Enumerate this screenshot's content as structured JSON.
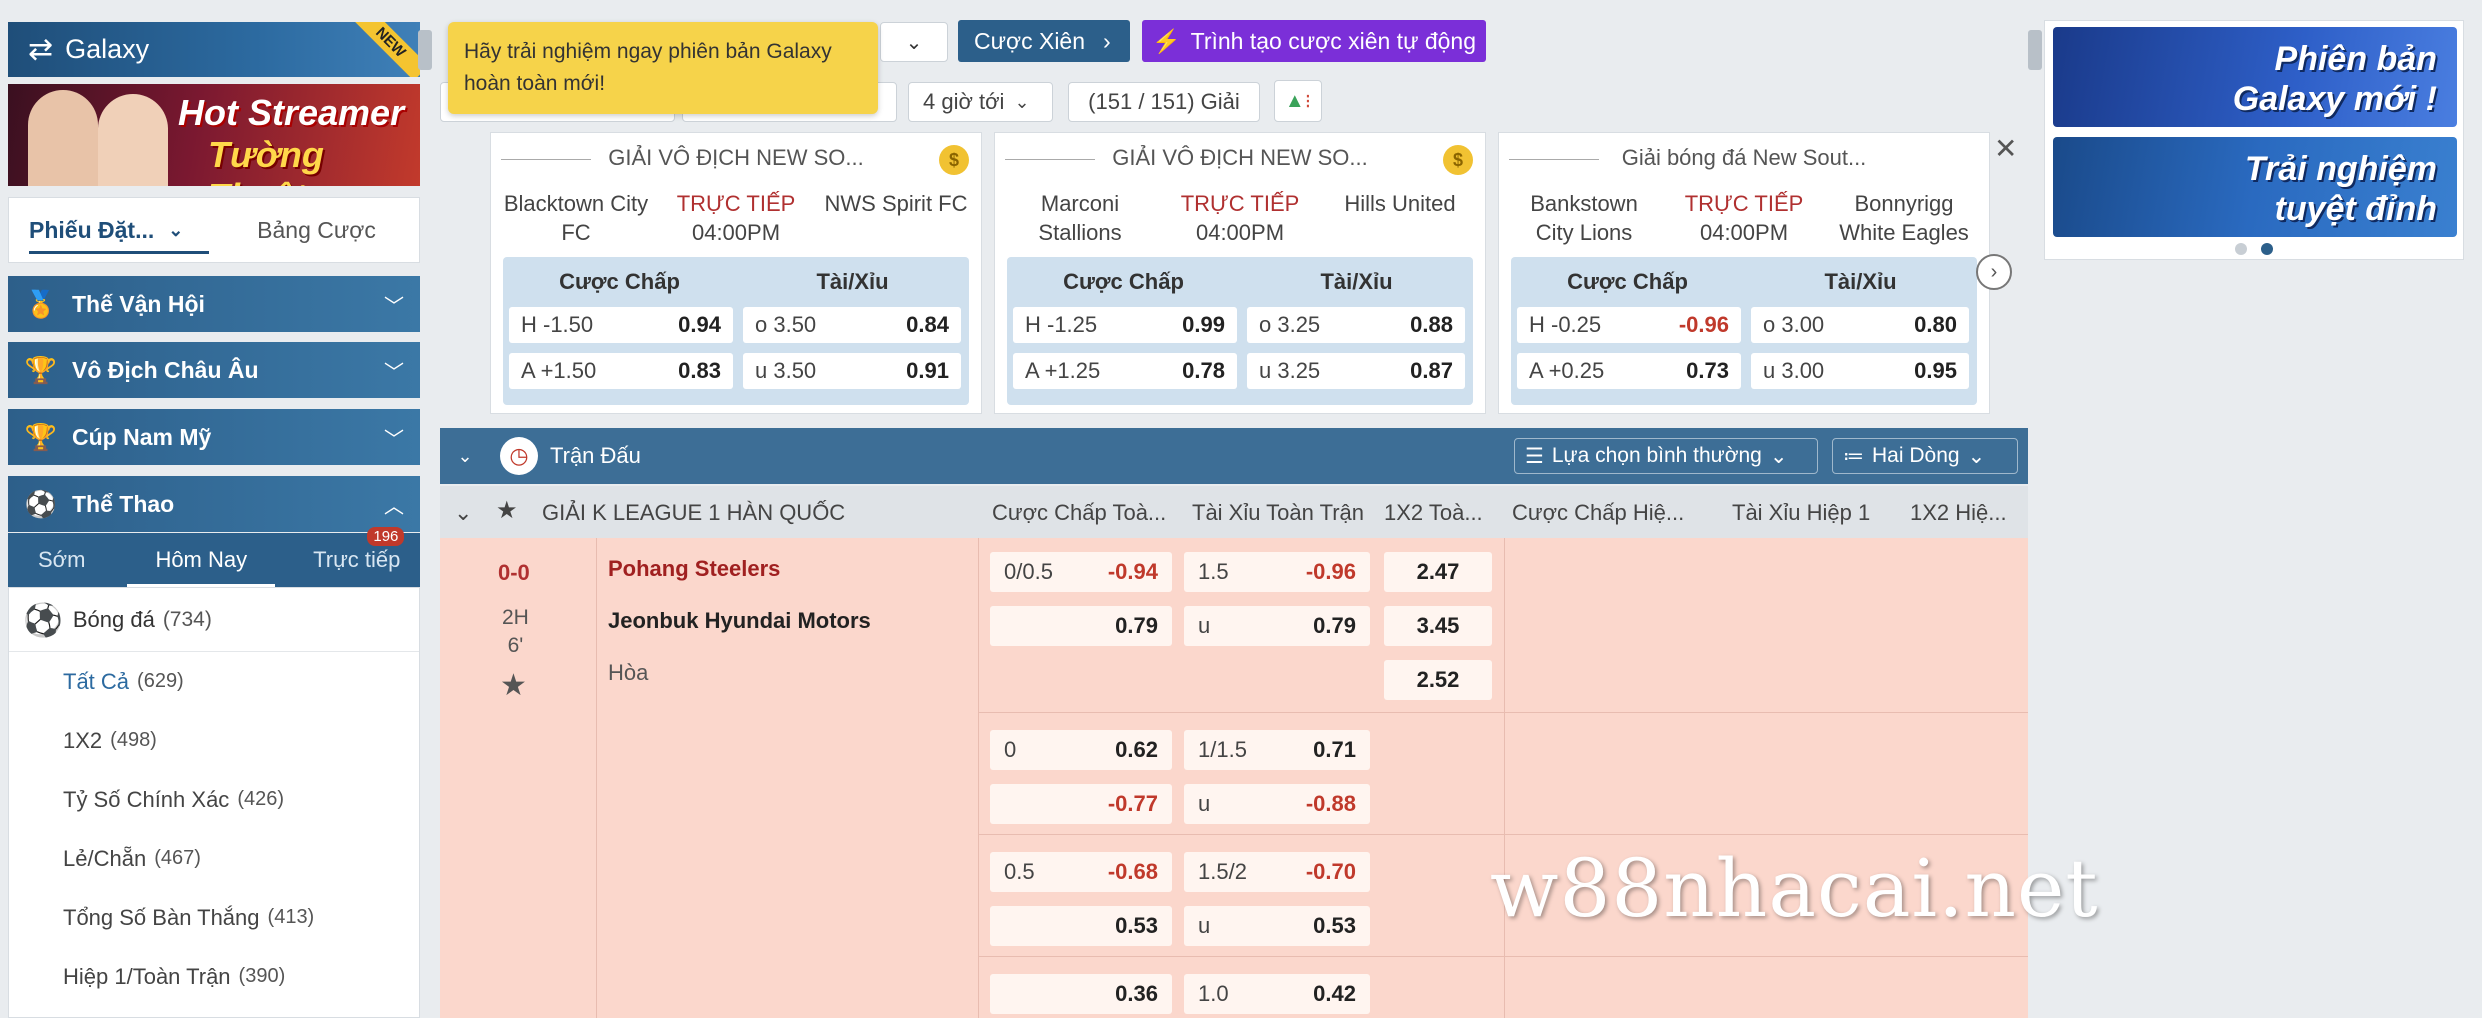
{
  "sidebar": {
    "brand": "Galaxy",
    "brand_tag": "NEW",
    "streamer_banner": {
      "line1": "Hot Streamer",
      "line2": "Tường Thuật"
    },
    "tabs": [
      {
        "label": "Phiếu Đặt..."
      },
      {
        "label": "Bảng Cược"
      }
    ],
    "sections": [
      {
        "label": "Thế Vận Hội"
      },
      {
        "label": "Vô Địch Châu Âu"
      },
      {
        "label": "Cúp Nam Mỹ"
      },
      {
        "label": "Thể Thao"
      }
    ],
    "day_tabs": [
      {
        "label": "Sớm"
      },
      {
        "label": "Hôm Nay"
      },
      {
        "label": "Trực tiếp"
      }
    ],
    "live_count": "196",
    "sport": {
      "label": "Bóng đá",
      "count": "(734)"
    },
    "sub_items": [
      {
        "label": "Tất Cả",
        "count": "(629)"
      },
      {
        "label": "1X2",
        "count": "(498)"
      },
      {
        "label": "Tỷ Số Chính Xác",
        "count": "(426)"
      },
      {
        "label": "Lẻ/Chẵn",
        "count": "(467)"
      },
      {
        "label": "Tổng Số Bàn Thắng",
        "count": "(413)"
      },
      {
        "label": "Hiệp 1/Toàn Trận",
        "count": "(390)"
      }
    ]
  },
  "toolbar": {
    "tooltip": "Hãy trải nghiệm ngay phiên bản Galaxy hoàn toàn mới!",
    "parlay_label": "Cược Xiên",
    "auto_parlay_label": "Trình tạo cược xiên tự động",
    "time_filter": "4 giờ tới",
    "league_count": "(151 / 151) Giải"
  },
  "cards": [
    {
      "league": "GIẢI VÔ ĐỊCH NEW SO...",
      "home": "Blacktown City FC",
      "away": "NWS Spirit FC",
      "status": "TRỰC TIẾP",
      "time": "04:00PM",
      "hdr_handicap": "Cược Chấp",
      "hdr_ou": "Tài/Xỉu",
      "h_line": "H -1.50",
      "h_odds": "0.94",
      "a_line": "A +1.50",
      "a_odds": "0.83",
      "o_line": "o 3.50",
      "o_odds": "0.84",
      "u_line": "u 3.50",
      "u_odds": "0.91"
    },
    {
      "league": "GIẢI VÔ ĐỊCH NEW SO...",
      "home": "Marconi Stallions",
      "away": "Hills United",
      "status": "TRỰC TIẾP",
      "time": "04:00PM",
      "hdr_handicap": "Cược Chấp",
      "hdr_ou": "Tài/Xỉu",
      "h_line": "H -1.25",
      "h_odds": "0.99",
      "a_line": "A +1.25",
      "a_odds": "0.78",
      "o_line": "o 3.25",
      "o_odds": "0.88",
      "u_line": "u 3.25",
      "u_odds": "0.87"
    },
    {
      "league": "Giải bóng đá New Sout...",
      "home": "Bankstown City Lions",
      "away": "Bonnyrigg White Eagles",
      "status": "TRỰC TIẾP",
      "time": "04:00PM",
      "hdr_handicap": "Cược Chấp",
      "hdr_ou": "Tài/Xỉu",
      "h_line": "H -0.25",
      "h_odds": "-0.96",
      "a_line": "A +0.25",
      "a_odds": "0.73",
      "o_line": "o 3.00",
      "o_odds": "0.80",
      "u_line": "u 3.00",
      "u_odds": "0.95"
    }
  ],
  "banners": {
    "b1": "Phiên bản Galaxy mới !",
    "b2": "Trải nghiệm tuyệt đỉnh"
  },
  "table": {
    "title": "Trận Đấu",
    "view_select": "Lựa chọn bình thường",
    "line_select": "Hai Dòng",
    "league": "GIẢI K LEAGUE 1 HÀN QUỐC",
    "columns": [
      "Cược Chấp Toà...",
      "Tài Xỉu Toàn Trận",
      "1X2 Toà...",
      "Cược Chấp Hiệ...",
      "Tài Xỉu Hiệp 1",
      "1X2 Hiệ..."
    ],
    "match": {
      "score": "0-0",
      "period": "2H",
      "minute": "6'",
      "home": "Pohang Steelers",
      "away": "Jeonbuk Hyundai Motors",
      "draw": "Hòa"
    },
    "handicap_rows": [
      {
        "line": "0/0.5",
        "top": "-0.94",
        "bottom": "0.79"
      },
      {
        "line": "0",
        "top": "0.62",
        "bottom": "-0.77"
      },
      {
        "line": "0.5",
        "top": "-0.68",
        "bottom": "0.53"
      },
      {
        "line": "",
        "top": "0.36",
        "bottom": ""
      }
    ],
    "ou_rows": [
      {
        "line": "1.5",
        "top": "-0.96",
        "u": "u",
        "bottom": "0.79"
      },
      {
        "line": "1/1.5",
        "top": "0.71",
        "u": "u",
        "bottom": "-0.88"
      },
      {
        "line": "1.5/2",
        "top": "-0.70",
        "u": "u",
        "bottom": "0.53"
      },
      {
        "line": "1.0",
        "top": "0.42",
        "u": "",
        "bottom": ""
      }
    ],
    "x12": [
      "2.47",
      "3.45",
      "2.52"
    ]
  },
  "watermark": "w88nhacai.net"
}
